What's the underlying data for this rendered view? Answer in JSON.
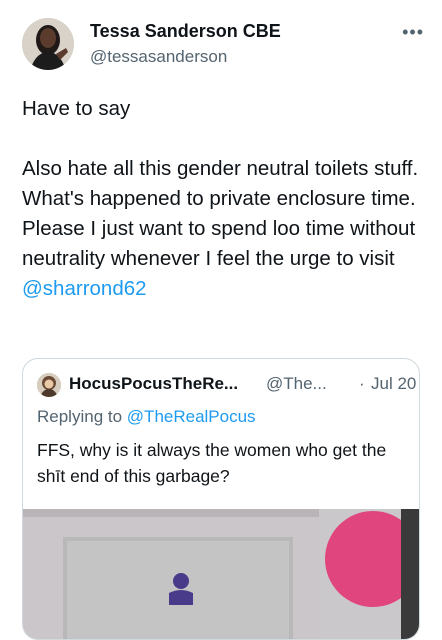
{
  "author": {
    "display_name": "Tessa Sanderson CBE",
    "handle": "@tessasanderson",
    "avatar_icon": "profile-photo"
  },
  "more_icon": "more-horizontal-icon",
  "post": {
    "line1": "Have to say",
    "line2": "Also hate all this gender neutral toilets stuff. What's happened to private enclosure time. Please I just want to spend loo time without neutrality whenever I feel the urge to visit",
    "mention": "@sharrond62"
  },
  "quoted": {
    "display_name": "HocusPocusTheRe...",
    "handle": "@The...",
    "separator": "·",
    "time": "Jul 20",
    "reply_prefix": "Replying to",
    "reply_to": "@TheRealPocus",
    "text": "FFS, why is it always the women who get the shīt end of this garbage?"
  },
  "colors": {
    "link": "#1d9bf0",
    "secondary_text": "#536471",
    "border": "#cfd9de"
  }
}
